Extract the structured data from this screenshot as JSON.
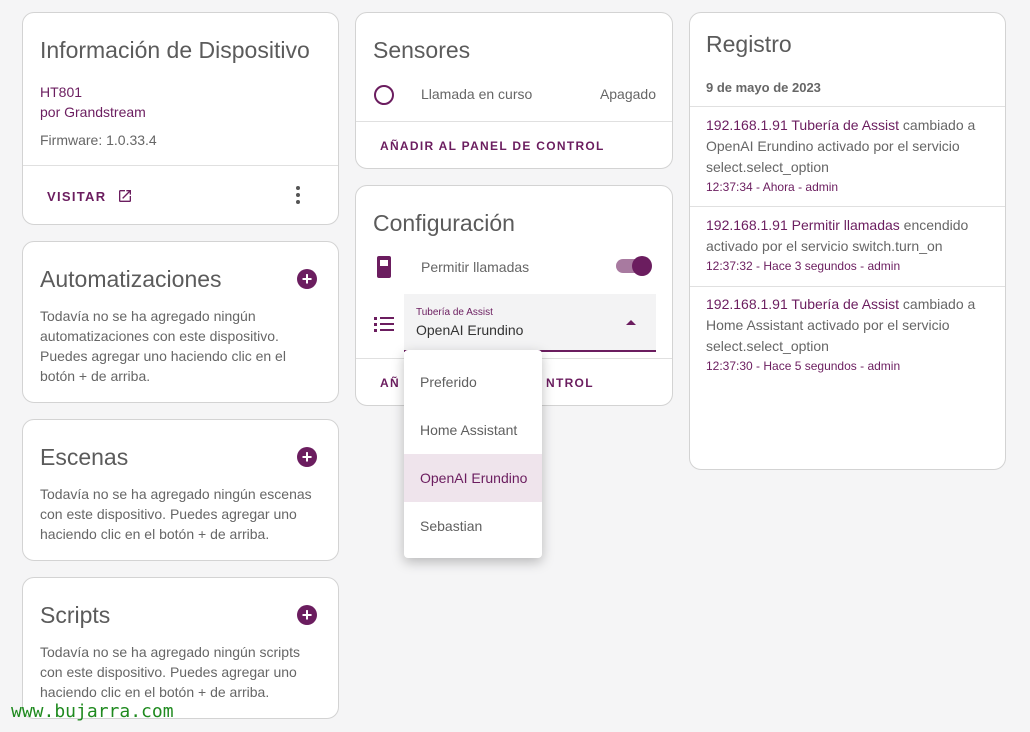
{
  "device_info": {
    "title": "Información de Dispositivo",
    "model": "HT801",
    "manufacturer": "por Grandstream",
    "firmware": "Firmware: 1.0.33.4",
    "visit_label": "VISITAR"
  },
  "automations": {
    "title": "Automatizaciones",
    "text": "Todavía no se ha agregado ningún automatizaciones con este dispositivo. Puedes agregar uno haciendo clic en el botón + de arriba."
  },
  "scenes": {
    "title": "Escenas",
    "text": "Todavía no se ha agregado ningún escenas con este dispositivo. Puedes agregar uno haciendo clic en el botón + de arriba."
  },
  "scripts": {
    "title": "Scripts",
    "text": "Todavía no se ha agregado ningún scripts con este dispositivo. Puedes agregar uno haciendo clic en el botón + de arriba."
  },
  "sensors": {
    "title": "Sensores",
    "items": [
      {
        "label": "Llamada en curso",
        "value": "Apagado"
      }
    ],
    "add_label": "AÑADIR AL PANEL DE CONTROL"
  },
  "config": {
    "title": "Configuración",
    "toggle_label": "Permitir llamadas",
    "toggle_on": true,
    "select_label": "Tubería de Assist",
    "select_value": "OpenAI Erundino",
    "add_label_visible_left": "AÑ",
    "add_label_visible_right": "NTROL",
    "options": [
      "Preferido",
      "Home Assistant",
      "OpenAI Erundino",
      "Sebastian"
    ],
    "selected_index": 2
  },
  "log": {
    "title": "Registro",
    "date": "9 de mayo de 2023",
    "entries": [
      {
        "source": "192.168.1.91 Tubería de Assist",
        "text": " cambiado a OpenAI Erundino activado por el servicio select.select_option",
        "time": "12:37:34 - Ahora - admin"
      },
      {
        "source": "192.168.1.91 Permitir llamadas",
        "text": " encendido activado por el servicio switch.turn_on",
        "time": "12:37:32 - Hace 3 segundos - admin"
      },
      {
        "source": "192.168.1.91 Tubería de Assist",
        "text": " cambiado a Home Assistant activado por el servicio select.select_option",
        "time": "12:37:30 - Hace 5 segundos - admin"
      }
    ]
  },
  "watermark": "www.bujarra.com",
  "colors": {
    "accent": "#6b1d5f",
    "background": "#f5f5f6"
  }
}
